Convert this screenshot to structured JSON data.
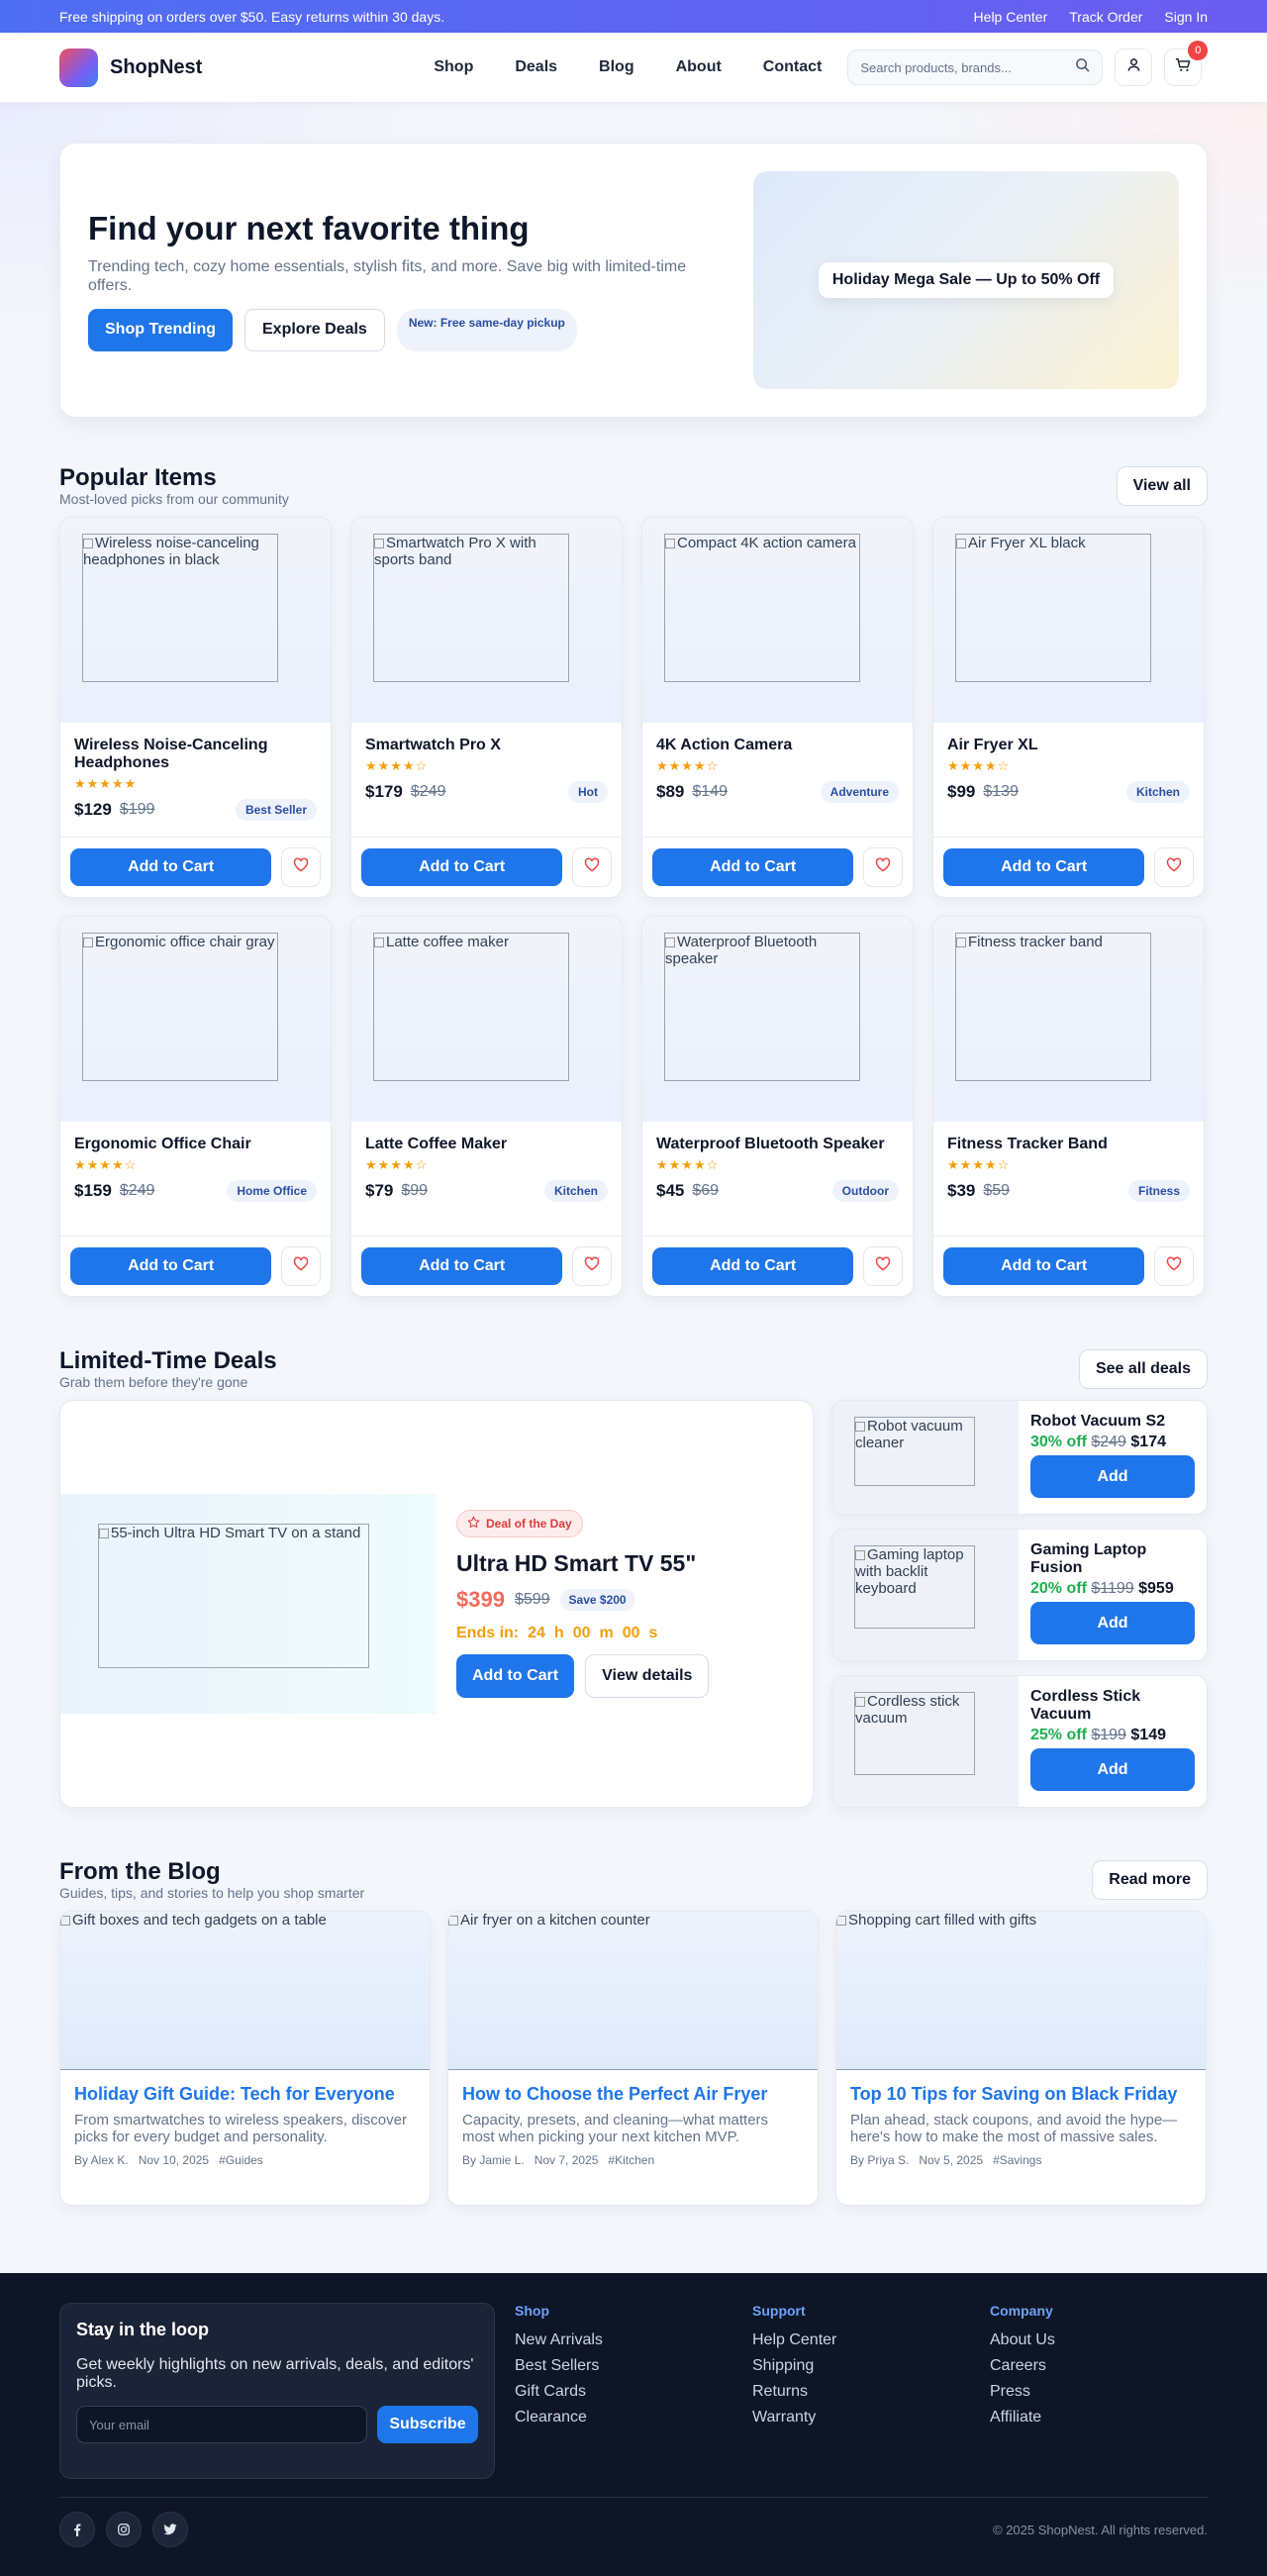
{
  "topbar": {
    "message": "Free shipping on orders over $50. Easy returns within 30 days.",
    "links": [
      "Help Center",
      "Track Order",
      "Sign In"
    ]
  },
  "header": {
    "brand": "ShopNest",
    "nav": [
      "Shop",
      "Deals",
      "Blog",
      "About",
      "Contact"
    ],
    "search_placeholder": "Search products, brands...",
    "cart_count": "0"
  },
  "hero": {
    "title": "Find your next favorite thing",
    "subtitle": "Trending tech, cozy home essentials, stylish fits, and more. Save big with limited-time offers.",
    "primary_label": "Shop Trending",
    "secondary_label": "Explore Deals",
    "note": "New: Free same-day pickup",
    "banner": "Holiday Mega Sale — Up to 50% Off"
  },
  "popular": {
    "title": "Popular Items",
    "subtitle": "Most-loved picks from our community",
    "view_all": "View all",
    "add_label": "Add to Cart",
    "items": [
      {
        "alt": "Wireless noise-canceling headphones in black",
        "name": "Wireless Noise-Canceling Headphones",
        "stars": "★★★★★",
        "rating": 5,
        "price": "$129",
        "old_price": "$199",
        "tag": "Best Seller"
      },
      {
        "alt": "Smartwatch Pro X with sports band",
        "name": "Smartwatch Pro X",
        "stars": "★★★★☆",
        "rating": 4,
        "price": "$179",
        "old_price": "$249",
        "tag": "Hot"
      },
      {
        "alt": "Compact 4K action camera",
        "name": "4K Action Camera",
        "stars": "★★★★☆",
        "rating": 4,
        "price": "$89",
        "old_price": "$149",
        "tag": "Adventure"
      },
      {
        "alt": "Air Fryer XL black",
        "name": "Air Fryer XL",
        "stars": "★★★★☆",
        "rating": 4,
        "price": "$99",
        "old_price": "$139",
        "tag": "Kitchen"
      },
      {
        "alt": "Ergonomic office chair gray",
        "name": "Ergonomic Office Chair",
        "stars": "★★★★☆",
        "rating": 4,
        "price": "$159",
        "old_price": "$249",
        "tag": "Home Office"
      },
      {
        "alt": "Latte coffee maker",
        "name": "Latte Coffee Maker",
        "stars": "★★★★☆",
        "rating": 4,
        "price": "$79",
        "old_price": "$99",
        "tag": "Kitchen"
      },
      {
        "alt": "Waterproof Bluetooth speaker",
        "name": "Waterproof Bluetooth Speaker",
        "stars": "★★★★☆",
        "rating": 4,
        "price": "$45",
        "old_price": "$69",
        "tag": "Outdoor"
      },
      {
        "alt": "Fitness tracker band",
        "name": "Fitness Tracker Band",
        "stars": "★★★★☆",
        "rating": 4,
        "price": "$39",
        "old_price": "$59",
        "tag": "Fitness"
      }
    ]
  },
  "deals": {
    "title": "Limited-Time Deals",
    "subtitle": "Grab them before they're gone",
    "see_all": "See all deals",
    "featured": {
      "alt": "55-inch Ultra HD Smart TV on a stand",
      "badge": "Deal of the Day",
      "name": "Ultra HD Smart TV 55\"",
      "price": "$399",
      "old_price": "$599",
      "save": "Save $200",
      "ends_label": "Ends in:",
      "hours": "24",
      "hours_unit": "h",
      "minutes": "00",
      "minutes_unit": "m",
      "seconds": "00",
      "seconds_unit": "s",
      "add_label": "Add to Cart",
      "details_label": "View details"
    },
    "side": [
      {
        "alt": "Robot vacuum cleaner",
        "name": "Robot Vacuum S2",
        "off": "30% off",
        "was": "$249",
        "now": "$174",
        "add": "Add"
      },
      {
        "alt": "Gaming laptop with backlit keyboard",
        "name": "Gaming Laptop Fusion",
        "off": "20% off",
        "was": "$1199",
        "now": "$959",
        "add": "Add"
      },
      {
        "alt": "Cordless stick vacuum",
        "name": "Cordless Stick Vacuum",
        "off": "25% off",
        "was": "$199",
        "now": "$149",
        "add": "Add"
      }
    ]
  },
  "blog": {
    "title": "From the Blog",
    "subtitle": "Guides, tips, and stories to help you shop smarter",
    "read_more": "Read more",
    "posts": [
      {
        "alt": "Gift boxes and tech gadgets on a table",
        "title": "Holiday Gift Guide: Tech for Everyone",
        "excerpt": "From smartwatches to wireless speakers, discover picks for every budget and personality.",
        "author": "By Alex K.",
        "date": "Nov 10, 2025",
        "tag": "#Guides"
      },
      {
        "alt": "Air fryer on a kitchen counter",
        "title": "How to Choose the Perfect Air Fryer",
        "excerpt": "Capacity, presets, and cleaning—what matters most when picking your next kitchen MVP.",
        "author": "By Jamie L.",
        "date": "Nov 7, 2025",
        "tag": "#Kitchen"
      },
      {
        "alt": "Shopping cart filled with gifts",
        "title": "Top 10 Tips for Saving on Black Friday",
        "excerpt": "Plan ahead, stack coupons, and avoid the hype—here's how to make the most of massive sales.",
        "author": "By Priya S.",
        "date": "Nov 5, 2025",
        "tag": "#Savings"
      }
    ]
  },
  "footer": {
    "news_title": "Stay in the loop",
    "news_text": "Get weekly highlights on new arrivals, deals, and editors' picks.",
    "email_placeholder": "Your email",
    "subscribe": "Subscribe",
    "columns": [
      {
        "title": "Shop",
        "links": [
          "New Arrivals",
          "Best Sellers",
          "Gift Cards",
          "Clearance"
        ]
      },
      {
        "title": "Support",
        "links": [
          "Help Center",
          "Shipping",
          "Returns",
          "Warranty"
        ]
      },
      {
        "title": "Company",
        "links": [
          "About Us",
          "Careers",
          "Press",
          "Affiliate"
        ]
      }
    ],
    "socials": [
      "facebook-icon",
      "instagram-icon",
      "twitter-icon"
    ],
    "copyright": "© 2025 ShopNest. All rights reserved."
  },
  "colors": {
    "primary": "#1f75ea",
    "topbar_start": "#4e6ef2",
    "topbar_end": "#6b5cf0",
    "deal_price": "#f26b5b",
    "countdown": "#f59e0b",
    "discount": "#1fae4f",
    "footer_bg": "#0e1527"
  }
}
